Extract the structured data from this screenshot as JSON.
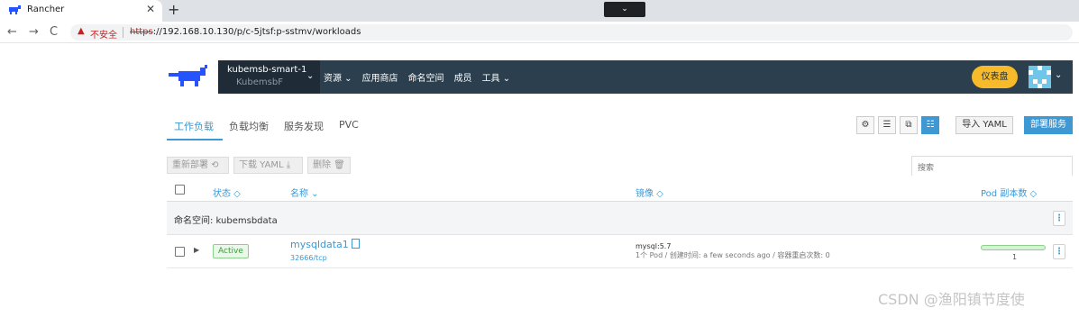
{
  "browser": {
    "tab_title": "Rancher",
    "tab_close": "✕",
    "new_tab": "+",
    "tabstrip_dropdown": "⌄",
    "back": "←",
    "forward": "→",
    "reload": "C",
    "security_icon": "▲",
    "security_warning": "不安全",
    "url_scheme": "https",
    "url_rest": "://192.168.10.130/p/c-5jtsf:p-sstmv/workloads"
  },
  "header": {
    "cluster_name": "kubemsb-smart-1",
    "project_name": "KubemsbF",
    "caret": "⌄",
    "nav": [
      {
        "label": "资源 ⌄"
      },
      {
        "label": "应用商店"
      },
      {
        "label": "命名空间"
      },
      {
        "label": "成员"
      },
      {
        "label": "工具 ⌄"
      }
    ],
    "dashboard_label": "仪表盘",
    "avatar_caret": "⌄"
  },
  "subtabs": [
    {
      "label": "工作负载"
    },
    {
      "label": "负载均衡"
    },
    {
      "label": "服务发现"
    },
    {
      "label": "PVC"
    }
  ],
  "view_buttons": [
    "⚙",
    "☰",
    "⧉",
    "☷"
  ],
  "actions": {
    "import_label": "导入 YAML",
    "deploy_label": "部署服务"
  },
  "bulk": {
    "redeploy": "重新部署 ⟲",
    "download": "下载 YAML ⤓",
    "delete": "删除 🗑"
  },
  "search": {
    "placeholder": "搜索"
  },
  "columns": {
    "state": "状态 ◇",
    "name": "名称 ⌄",
    "image": "镜像 ◇",
    "pods": "Pod 副本数 ◇"
  },
  "group": {
    "label": "命名空间: kubemsbdata"
  },
  "kebab": "⋮",
  "row": {
    "expand": "▶",
    "status": "Active",
    "name": "mysqldata1",
    "port": "32666/tcp",
    "image": "mysql:5.7",
    "image_detail": "1个 Pod / 创建时间: a few seconds ago / 容器重启次数: 0",
    "pod_count": "1",
    "pod_ratio": 1.0
  },
  "watermark": "CSDN @渔阳镇节度使"
}
